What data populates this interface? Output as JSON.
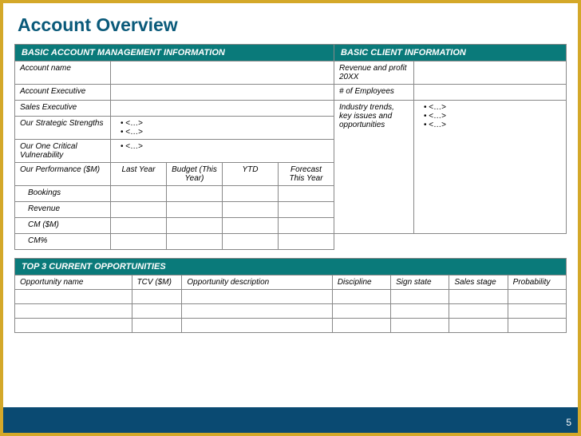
{
  "title": "Account Overview",
  "sections": {
    "left_header": "BASIC ACCOUNT MANAGEMENT INFORMATION",
    "right_header": "BASIC CLIENT INFORMATION"
  },
  "left": {
    "account_name": "Account name",
    "account_exec": "Account Executive",
    "sales_exec": "Sales Executive",
    "strengths_label": "Our Strategic Strengths",
    "strengths": [
      "<…>",
      "<…>"
    ],
    "vuln_label": "Our One Critical Vulnerability",
    "vuln": [
      "<…>"
    ],
    "perf_label": "Our Performance ($M)",
    "perf_cols": [
      "Last Year",
      "Budget (This Year)",
      "YTD",
      "Forecast This Year"
    ],
    "perf_rows": [
      "Bookings",
      "Revenue",
      "CM ($M)",
      "CM%"
    ]
  },
  "right": {
    "rev_label": "Revenue and profit 20XX",
    "emp_label": "# of Employees",
    "trends_label": "Industry trends, key issues and opportunities",
    "trends": [
      "<…>",
      "<…>",
      "<…>"
    ]
  },
  "opps": {
    "header": "TOP 3 CURRENT OPPORTUNITIES",
    "cols": [
      "Opportunity name",
      "TCV ($M)",
      "Opportunity description",
      "Discipline",
      "Sign state",
      "Sales stage",
      "Probability"
    ]
  },
  "page_number": "5"
}
